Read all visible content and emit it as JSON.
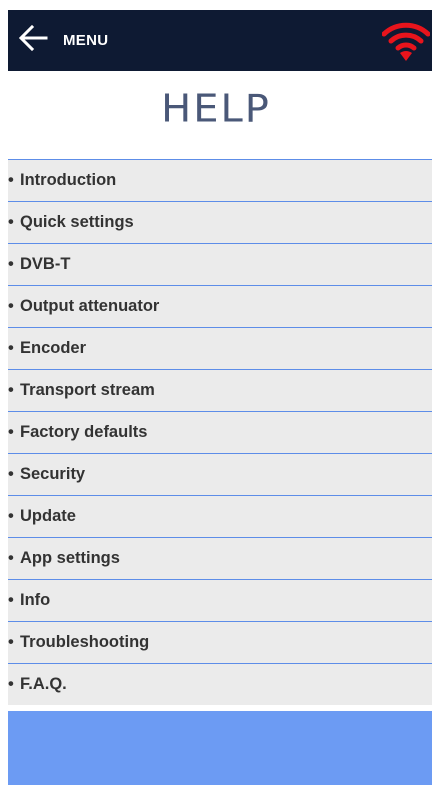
{
  "header": {
    "menu_label": "MENU",
    "back_icon": "arrow-left-icon",
    "status_icon": "wifi-icon",
    "bg_color": "#0e1a33",
    "status_color": "#e8141c"
  },
  "page": {
    "title": "HELP"
  },
  "help": {
    "bullet": "•",
    "items": [
      {
        "label": "Introduction"
      },
      {
        "label": "Quick settings"
      },
      {
        "label": "DVB-T"
      },
      {
        "label": "Output attenuator"
      },
      {
        "label": "Encoder"
      },
      {
        "label": "Transport stream"
      },
      {
        "label": "Factory defaults"
      },
      {
        "label": "Security"
      },
      {
        "label": "Update"
      },
      {
        "label": "App settings"
      },
      {
        "label": "Info"
      },
      {
        "label": "Troubleshooting"
      },
      {
        "label": "F.A.Q."
      }
    ]
  },
  "colors": {
    "list_bg": "#ebebeb",
    "divider": "#5d8de8",
    "footer": "#6c9bf3"
  }
}
